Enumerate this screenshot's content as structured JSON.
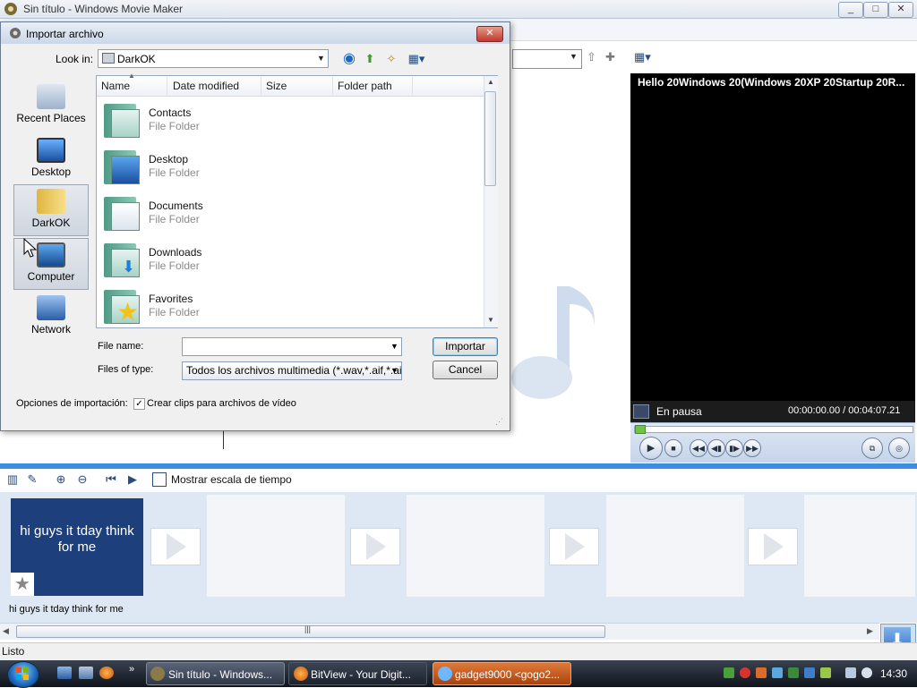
{
  "app": {
    "title": "Sin título - Windows Movie Maker",
    "caption_buttons": {
      "minimize": "_",
      "maximize": "□",
      "close": "✕"
    }
  },
  "preview": {
    "title": "Hello 20Windows 20(Windows 20XP 20Startup 20R...",
    "status": "En pausa",
    "time": "00:00:00.00 / 00:04:07.21"
  },
  "storyboard_toolbar": {
    "timeline_label": "Mostrar escala de tiempo"
  },
  "storyboard": {
    "clip1": {
      "thumb_text": "hi guys it tday think for me",
      "caption": "hi guys it tday think for me"
    }
  },
  "statusbar": {
    "text": "Listo"
  },
  "dialog": {
    "title": "Importar archivo",
    "close": "✕",
    "look_in_label": "Look in:",
    "look_in_value": "DarkOK",
    "places": [
      {
        "label": "Recent Places",
        "icon": "recent-places-icon"
      },
      {
        "label": "Desktop",
        "icon": "desktop-icon"
      },
      {
        "label": "DarkOK",
        "icon": "user-folder-icon"
      },
      {
        "label": "Computer",
        "icon": "computer-icon"
      },
      {
        "label": "Network",
        "icon": "network-icon"
      }
    ],
    "columns": [
      "Name",
      "Date modified",
      "Size",
      "Folder path"
    ],
    "items": [
      {
        "name": "Contacts",
        "type": "File Folder"
      },
      {
        "name": "Desktop",
        "type": "File Folder"
      },
      {
        "name": "Documents",
        "type": "File Folder"
      },
      {
        "name": "Downloads",
        "type": "File Folder"
      },
      {
        "name": "Favorites",
        "type": "File Folder"
      }
    ],
    "file_name_label": "File name:",
    "file_name_value": "",
    "files_of_type_label": "Files of type:",
    "files_of_type_value": "Todos los archivos multimedia (*.wav,*.aif,*.aiff,",
    "import_button": "Importar",
    "cancel_button": "Cancel",
    "options_label": "Opciones de importación:",
    "create_clips_label": "Crear clips para archivos de vídeo",
    "create_clips_checked": true
  },
  "taskbar": {
    "tasks": [
      {
        "label": "Sin título - Windows...",
        "active": true
      },
      {
        "label": "BitView - Your Digit...",
        "active": false
      },
      {
        "label": "gadget9000 <gogo2...",
        "active": false
      }
    ],
    "clock": "14:30"
  },
  "colors": {
    "accent_blue": "#3e8ee0",
    "preview_bg": "#000000",
    "clip_bg": "#1d3f7c",
    "taskbar": "#1a2029",
    "firefox_task": "#c8571b"
  }
}
